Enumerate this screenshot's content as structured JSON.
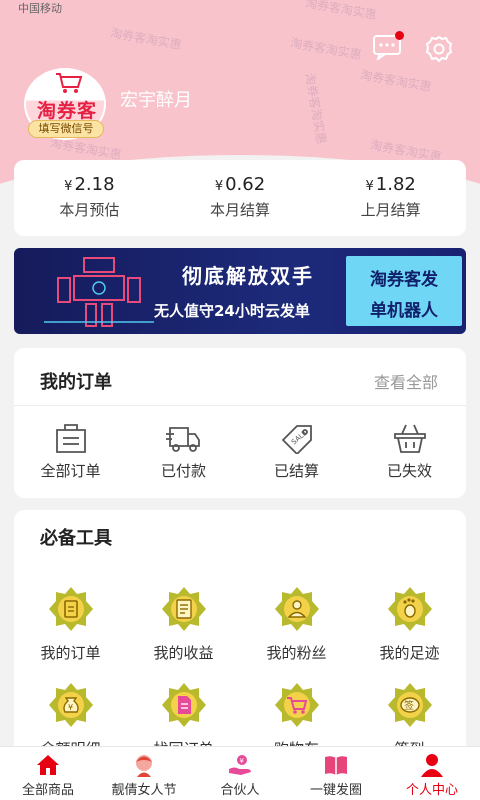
{
  "status_bar": {
    "carrier": "中国移动"
  },
  "watermark_text": "淘券客淘实惠",
  "profile": {
    "avatar_text": "淘券客",
    "wechat_tag": "填写微信号",
    "username": "宏宇醉月"
  },
  "earnings": [
    {
      "currency": "¥",
      "value": "2.18",
      "label": "本月预估"
    },
    {
      "currency": "¥",
      "value": "0.62",
      "label": "本月结算"
    },
    {
      "currency": "¥",
      "value": "1.82",
      "label": "上月结算"
    }
  ],
  "banner": {
    "headline": "彻底解放双手",
    "subline": "无人值守24小时云发单",
    "box_line1": "淘券客发",
    "box_line2": "单机器人"
  },
  "orders": {
    "title": "我的订单",
    "see_all": "查看全部",
    "items": [
      {
        "label": "全部订单",
        "icon": "order-list-icon"
      },
      {
        "label": "已付款",
        "icon": "delivery-truck-icon"
      },
      {
        "label": "已结算",
        "icon": "sale-tag-icon"
      },
      {
        "label": "已失效",
        "icon": "basket-icon"
      }
    ]
  },
  "tools": {
    "title": "必备工具",
    "items": [
      {
        "label": "我的订单",
        "icon": "order-icon"
      },
      {
        "label": "我的收益",
        "icon": "income-icon"
      },
      {
        "label": "我的粉丝",
        "icon": "fans-icon"
      },
      {
        "label": "我的足迹",
        "icon": "footprint-icon"
      },
      {
        "label": "余额明细",
        "icon": "money-bag-icon"
      },
      {
        "label": "找回订单",
        "icon": "document-icon"
      },
      {
        "label": "购物车",
        "icon": "cart-icon"
      },
      {
        "label": "签到",
        "icon": "sign-in-icon"
      }
    ]
  },
  "bottom_nav": [
    {
      "label": "全部商品",
      "icon": "home-icon",
      "active": false
    },
    {
      "label": "靓倩女人节",
      "icon": "girl-icon",
      "active": false
    },
    {
      "label": "合伙人",
      "icon": "partner-icon",
      "active": false
    },
    {
      "label": "一键发圈",
      "icon": "book-icon",
      "active": false
    },
    {
      "label": "个人中心",
      "icon": "person-icon",
      "active": true
    }
  ],
  "colors": {
    "header_pink": "#f9c3cc",
    "accent_red": "#e60012",
    "tool_badge": "#b9b92d",
    "banner_bg": "#151b5b",
    "banner_box": "#6fd6f5"
  }
}
